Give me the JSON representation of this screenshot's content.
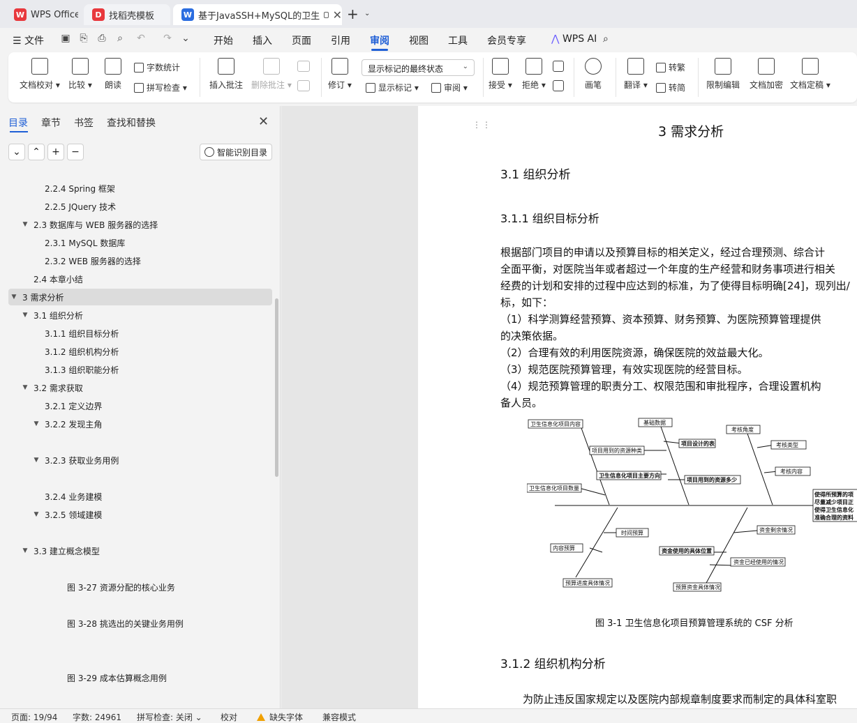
{
  "tabs": [
    {
      "label": "WPS Office",
      "icon": "wps-logo-icon",
      "color": "#e8383d"
    },
    {
      "label": "找稻壳模板",
      "icon": "docer-icon",
      "color": "#e8383d"
    },
    {
      "label": "基于JavaSSH+MySQL的卫生",
      "icon": "word-doc-icon",
      "color": "#2b6de0"
    }
  ],
  "menu": {
    "file": "文件",
    "items": [
      "开始",
      "插入",
      "页面",
      "引用",
      "审阅",
      "视图",
      "工具",
      "会员专享"
    ],
    "active": "审阅",
    "wps_ai": "WPS AI"
  },
  "ribbon": {
    "doc_check": "文档校对",
    "compare": "比较",
    "read_aloud": "朗读",
    "word_count": "字数统计",
    "spell_check": "拼写检查",
    "insert_comment": "插入批注",
    "delete_comment": "删除批注",
    "revise": "修订",
    "mark_state": "显示标记的最终状态",
    "show_marks": "显示标记",
    "review": "审阅",
    "accept": "接受",
    "reject": "拒绝",
    "brush": "画笔",
    "translate": "翻译",
    "to_trad": "转繁",
    "to_simp": "转简",
    "restrict_edit": "限制编辑",
    "encrypt": "文档加密",
    "finalize": "文档定稿"
  },
  "nav": {
    "tabs": [
      "目录",
      "章节",
      "书签",
      "查找和替换"
    ],
    "active": "目录",
    "smart_toc": "智能识别目录",
    "toc": [
      {
        "text": "2.2.4 Spring 框架",
        "level": 3,
        "arrow": false
      },
      {
        "text": "2.2.5 JQuery 技术",
        "level": 3,
        "arrow": false
      },
      {
        "text": "2.3 数据库与 WEB 服务器的选择",
        "level": 2,
        "arrow": true
      },
      {
        "text": "2.3.1 MySQL 数据库",
        "level": 3,
        "arrow": false
      },
      {
        "text": "2.3.2 WEB 服务器的选择",
        "level": 3,
        "arrow": false
      },
      {
        "text": "2.4 本章小结",
        "level": 2,
        "arrow": false
      },
      {
        "text": "3  需求分析",
        "level": 1,
        "arrow": true,
        "selected": true
      },
      {
        "text": "3.1 组织分析",
        "level": 2,
        "arrow": true
      },
      {
        "text": "3.1.1  组织目标分析",
        "level": 3,
        "arrow": false
      },
      {
        "text": "3.1.2 组织机构分析",
        "level": 3,
        "arrow": false
      },
      {
        "text": "3.1.3 组织职能分析",
        "level": 3,
        "arrow": false
      },
      {
        "text": "3.2  需求获取",
        "level": 2,
        "arrow": true
      },
      {
        "text": "3.2.1  定义边界",
        "level": 3,
        "arrow": false
      },
      {
        "text": "3.2.2  发现主角",
        "level": 3,
        "arrow": true
      },
      {
        "text": "3.2.3  获取业务用例",
        "level": 3,
        "arrow": true
      },
      {
        "text": "3.2.4 业务建模",
        "level": 3,
        "arrow": false
      },
      {
        "text": "3.2.5 领域建模",
        "level": 3,
        "arrow": true
      },
      {
        "text": "3.3 建立概念模型",
        "level": 2,
        "arrow": true
      },
      {
        "text": "图 3-27     资源分配的核心业务",
        "level": 5,
        "arrow": false
      },
      {
        "text": "图 3-28     挑选出的关键业务用例",
        "level": 5,
        "arrow": false
      },
      {
        "text": "图 3-29     成本估算概念用例",
        "level": 5,
        "arrow": false
      }
    ]
  },
  "doc": {
    "h1": "3  需求分析",
    "h2": "3.1 组织分析",
    "h3": "3.1.1  组织目标分析",
    "para": [
      "    根据部门项目的申请以及预算目标的相关定义，经过合理预测、综合计",
      "全面平衡，对医院当年或者超过一个年度的生产经营和财务事项进行相关",
      "经费的计划和安排的过程中应达到的标准，为了使得目标明确[24]，现列出/",
      "标，如下：",
      "    （1）科学测算经营预算、资本预算、财务预算、为医院预算管理提供",
      "的决策依据。",
      "    （2）合理有效的利用医院资源，确保医院的效益最大化。",
      "    （3）规范医院预算管理，有效实现医院的经营目标。",
      "    （4）规范预算管理的职责分工、权限范围和审批程序，合理设置机构",
      "备人员。"
    ],
    "figure": {
      "labels": {
        "l1": "卫生信息化项目内容",
        "l2": "基础数据",
        "l3": "考核角度",
        "l4": "项目设计的表",
        "l5": "考核类型",
        "l6": "项目用到的资源种类",
        "l7": "考核内容",
        "l8": "卫生信息化项目主要方向",
        "l9": "项目用到的资源多少",
        "l10": "卫生信息化项目数量",
        "l11": "使得所预算的项",
        "l12": "尽量减少项目正",
        "l13": "使得卫生信息化",
        "l14": "准确合理的资料",
        "l15": "时间预算",
        "l16": "资金剩余情况",
        "l17": "内容预算",
        "l18": "资金使用的具体位置",
        "l19": "资金已经使用的情况",
        "l20": "预算进度具体情况",
        "l21": "预算资金具体情况"
      },
      "caption": "图 3-1    卫生信息化项目预算管理系统的 CSF 分析"
    },
    "h2b": "3.1.2 组织机构分析",
    "last_line": "为防止违反国家规定以及医院内部规章制度要求而制定的具体科室职"
  },
  "status": {
    "page": "页面: 19/94",
    "words": "字数: 24961",
    "spell": "拼写检查: 关闭",
    "proof": "校对",
    "missing_font": "缺失字体",
    "compat": "兼容模式"
  },
  "colors": {
    "accent": "#1f5fd6",
    "warning": "#f0a000"
  }
}
